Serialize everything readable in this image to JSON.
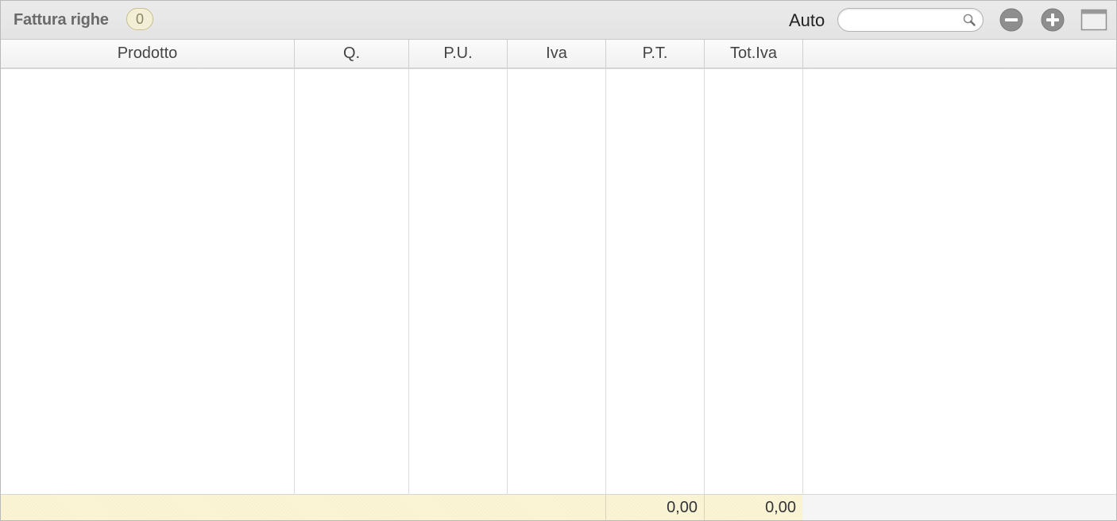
{
  "toolbar": {
    "title": "Fattura righe",
    "count": "0",
    "auto_label": "Auto",
    "search_value": "",
    "search_placeholder": ""
  },
  "table": {
    "columns": [
      "Prodotto",
      "Q.",
      "P.U.",
      "Iva",
      "P.T.",
      "Tot.Iva"
    ],
    "rows": [],
    "totals": {
      "pt": "0,00",
      "tot_iva": "0,00"
    }
  },
  "colors": {
    "toolbar_bg": "#e6e6e6",
    "badge_bg": "#f3efd7",
    "footer_bg": "#fbf5d6",
    "icon_gray": "#8c8c8c"
  },
  "icons": {
    "search": "search-icon",
    "remove": "minus-circle-icon",
    "add": "plus-circle-icon",
    "window": "window-icon"
  }
}
